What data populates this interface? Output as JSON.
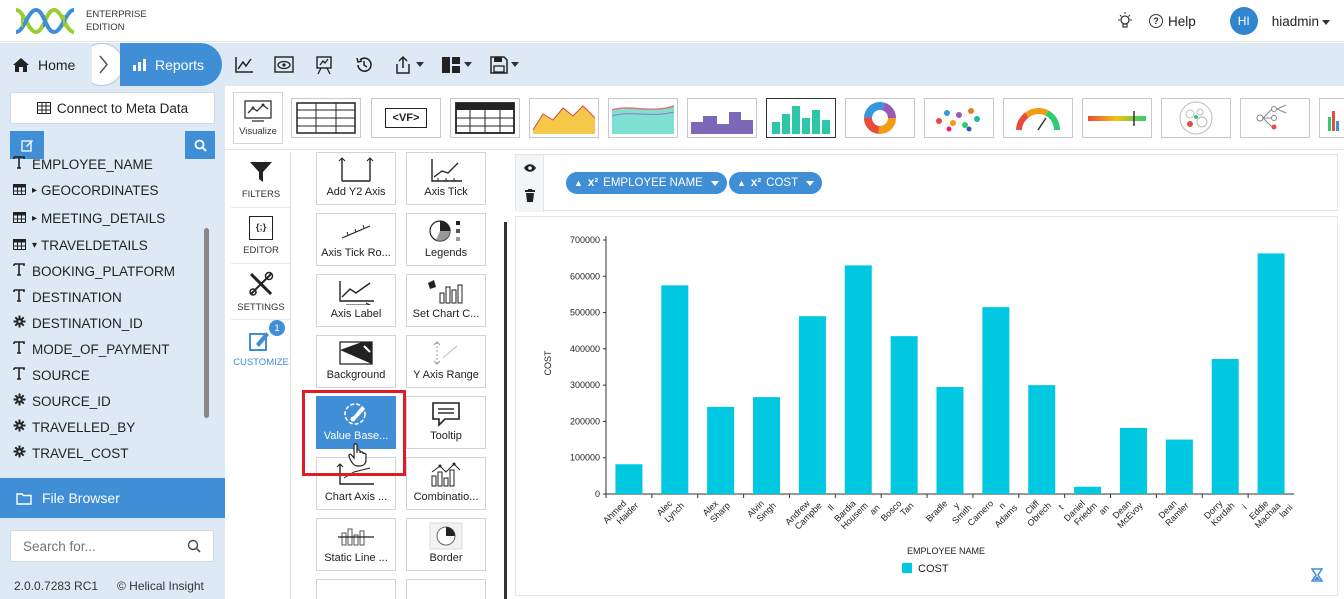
{
  "header": {
    "edition_line1": "ENTERPRISE",
    "edition_line2": "EDITION",
    "help_label": "Help",
    "avatar_initials": "HI",
    "username": "hiadmin"
  },
  "nav": {
    "home_label": "Home",
    "reports_label": "Reports"
  },
  "sidebar": {
    "connect_label": "Connect to Meta Data",
    "fields": [
      {
        "label": "EMPLOYEE_NAME",
        "icon": "text-icon"
      },
      {
        "label": "GEOCORDINATES",
        "icon": "table-icon"
      },
      {
        "label": "MEETING_DETAILS",
        "icon": "table-icon"
      },
      {
        "label": "TRAVELDETAILS",
        "icon": "table-icon"
      },
      {
        "label": "BOOKING_PLATFORM",
        "icon": "text-icon"
      },
      {
        "label": "DESTINATION",
        "icon": "text-icon"
      },
      {
        "label": "DESTINATION_ID",
        "icon": "gear-icon"
      },
      {
        "label": "MODE_OF_PAYMENT",
        "icon": "text-icon"
      },
      {
        "label": "SOURCE",
        "icon": "text-icon"
      },
      {
        "label": "SOURCE_ID",
        "icon": "gear-icon"
      },
      {
        "label": "TRAVELLED_BY",
        "icon": "gear-icon"
      },
      {
        "label": "TRAVEL_COST",
        "icon": "gear-icon"
      }
    ],
    "file_browser_label": "File Browser",
    "search_placeholder": "Search for...",
    "version": "2.0.0.7283 RC1",
    "copyright": "© Helical Insight"
  },
  "vizbar": {
    "visualize_label": "Visualize",
    "vf_label": "<VF>"
  },
  "rail": {
    "filters": "FILTERS",
    "editor": "EDITOR",
    "editor_glyph": "{;}",
    "settings": "SETTINGS",
    "customize": "CUSTOMIZE",
    "badge": "1"
  },
  "customize_tiles": [
    "Add Y2 Axis",
    "Axis Tick",
    "Axis Tick Ro...",
    "Legends",
    "Axis Label",
    "Set Chart C...",
    "Background",
    "Y Axis Range",
    "Value Base...",
    "Tooltip",
    "Chart Axis ...",
    "Combinatio...",
    "Static Line ...",
    "Border"
  ],
  "shelf": {
    "pill1_label": "EMPLOYEE NAME",
    "pill2_label": "COST",
    "pill_prefix": "x²"
  },
  "colors": {
    "accent": "#3f8ed6",
    "bar": "#00c8e0",
    "highlight": "#e01b24"
  },
  "chart_data": {
    "type": "bar",
    "categories": [
      "Ahmed Haider",
      "Alec Lynch",
      "Alex Sharp",
      "Alvin Singh",
      "Andrew Campbell",
      "Bardia Housseman",
      "Bosco Tan",
      "Bradley Smith",
      "Cameron Adams",
      "Cliff Obrecht",
      "Daniel Friedman",
      "Dean McEvoy",
      "Dean Ramler",
      "Dorry Kordahi",
      "Eddie Machaalani"
    ],
    "tick_lines": [
      [
        "Ahmed",
        "Haider"
      ],
      [
        "Alec",
        "Lynch"
      ],
      [
        "Alex",
        "Sharp"
      ],
      [
        "Alvin",
        "Singh"
      ],
      [
        "Andrew",
        "Campbe",
        "ll"
      ],
      [
        "Bardia",
        "Housem",
        "an"
      ],
      [
        "Bosco",
        "Tan"
      ],
      [
        "Bradle",
        "y",
        "Smith"
      ],
      [
        "Camero",
        "n",
        "Adams"
      ],
      [
        "Cliff",
        "Obrech",
        "t"
      ],
      [
        "Daniel",
        "Friedm",
        "an"
      ],
      [
        "Dean",
        "McEvoy"
      ],
      [
        "Dean",
        "Ramler"
      ],
      [
        "Dorry",
        "Kordah",
        "i"
      ],
      [
        "Eddie",
        "Machaa",
        "lani"
      ]
    ],
    "series": [
      {
        "name": "COST",
        "values": [
          82000,
          575000,
          240000,
          267000,
          490000,
          630000,
          435000,
          295000,
          515000,
          300000,
          20000,
          182000,
          150000,
          372000,
          663000
        ]
      }
    ],
    "xlabel": "EMPLOYEE NAME",
    "ylabel": "COST",
    "ylim": [
      0,
      700000
    ],
    "yticks": [
      0,
      100000,
      200000,
      300000,
      400000,
      500000,
      600000,
      700000
    ],
    "legend": "bottom-left",
    "grid": false
  }
}
